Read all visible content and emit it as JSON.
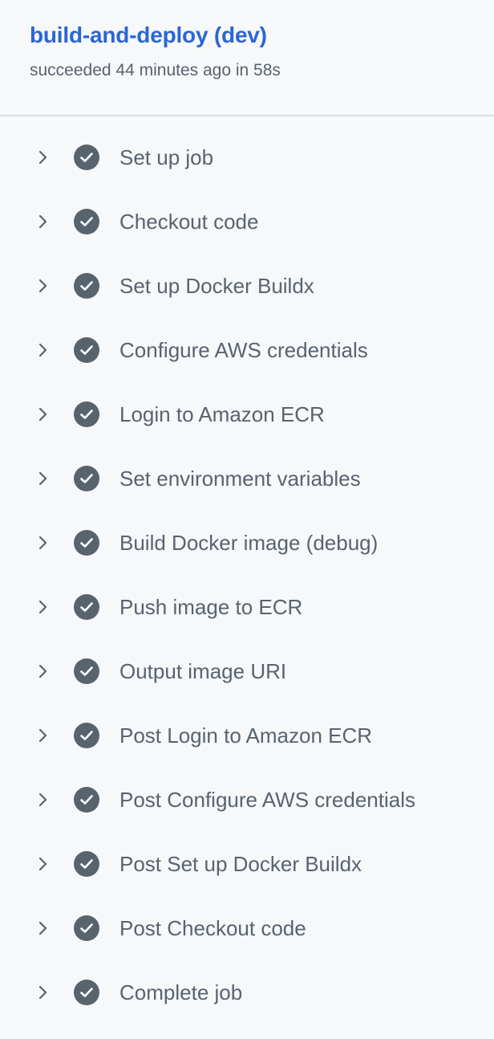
{
  "job": {
    "title": "build-and-deploy (dev)",
    "status_text": "succeeded 44 minutes ago in 58s",
    "title_color": "#2b66d4"
  },
  "steps": [
    {
      "label": "Set up job",
      "status": "success",
      "icon": "check-circle-icon"
    },
    {
      "label": "Checkout code",
      "status": "success",
      "icon": "check-circle-icon"
    },
    {
      "label": "Set up Docker Buildx",
      "status": "success",
      "icon": "check-circle-icon"
    },
    {
      "label": "Configure AWS credentials",
      "status": "success",
      "icon": "check-circle-icon"
    },
    {
      "label": "Login to Amazon ECR",
      "status": "success",
      "icon": "check-circle-icon"
    },
    {
      "label": "Set environment variables",
      "status": "success",
      "icon": "check-circle-icon"
    },
    {
      "label": "Build Docker image (debug)",
      "status": "success",
      "icon": "check-circle-icon"
    },
    {
      "label": "Push image to ECR",
      "status": "success",
      "icon": "check-circle-icon"
    },
    {
      "label": "Output image URI",
      "status": "success",
      "icon": "check-circle-icon"
    },
    {
      "label": "Post Login to Amazon ECR",
      "status": "success",
      "icon": "check-circle-icon"
    },
    {
      "label": "Post Configure AWS credentials",
      "status": "success",
      "icon": "check-circle-icon"
    },
    {
      "label": "Post Set up Docker Buildx",
      "status": "success",
      "icon": "check-circle-icon"
    },
    {
      "label": "Post Checkout code",
      "status": "success",
      "icon": "check-circle-icon"
    },
    {
      "label": "Complete job",
      "status": "success",
      "icon": "check-circle-icon"
    }
  ]
}
